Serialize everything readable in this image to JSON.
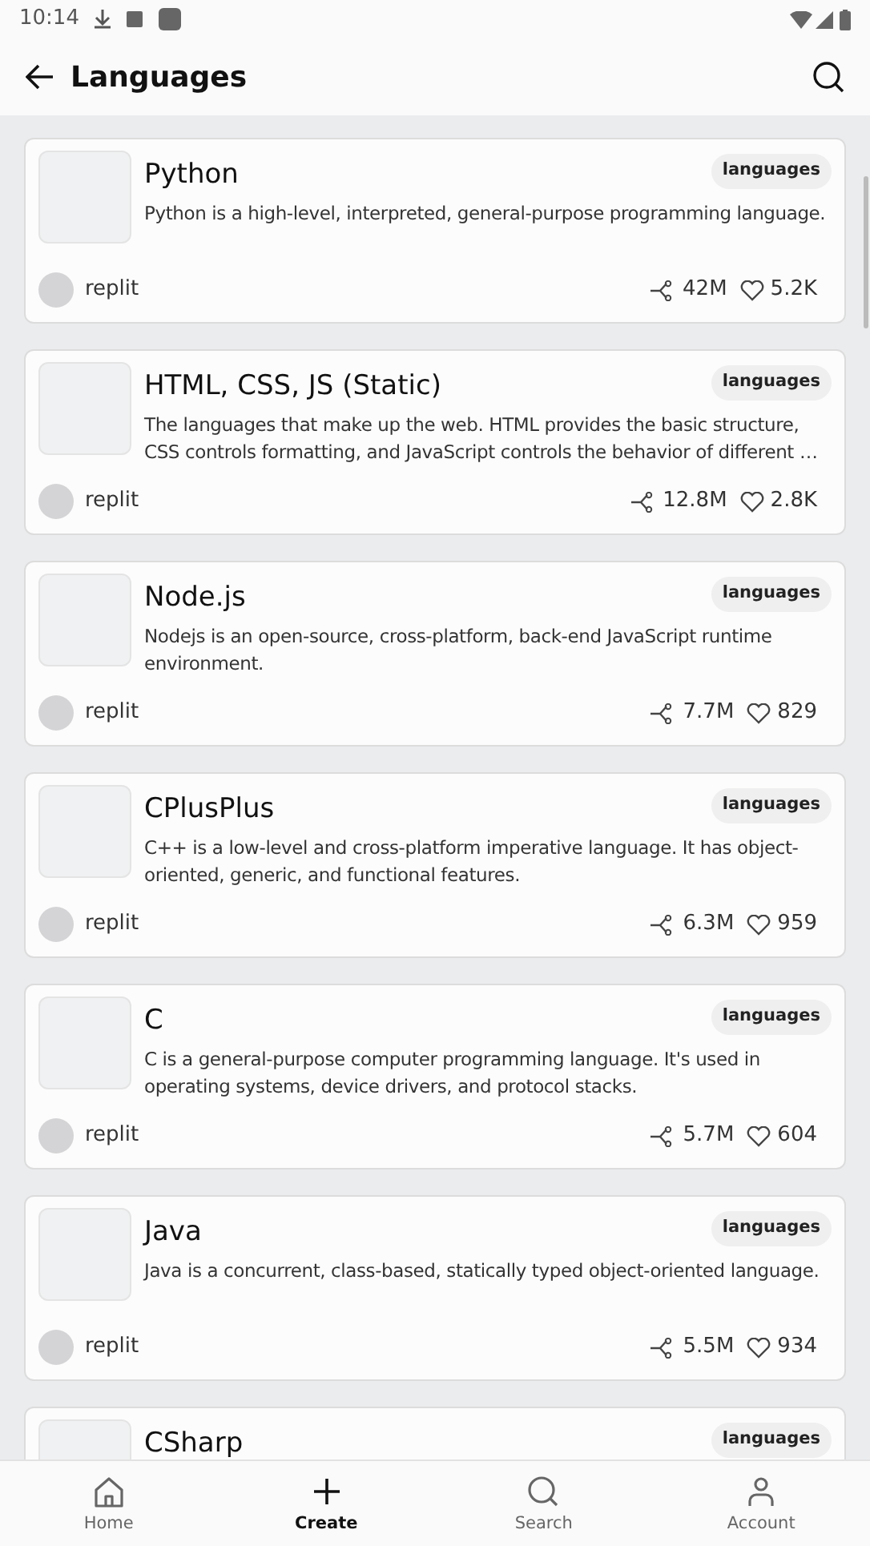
{
  "status_bar": {
    "time": "10:14"
  },
  "header": {
    "title": "Languages"
  },
  "cards": [
    {
      "title": "Python",
      "tag": "languages",
      "description": "Python is a high-level, interpreted, general-purpose programming language.",
      "author": "replit",
      "forks": "42M",
      "likes": "5.2K"
    },
    {
      "title": "HTML, CSS, JS (Static)",
      "tag": "languages",
      "description": "The languages that make up the web. HTML provides the basic structure, CSS controls formatting, and JavaScript controls the behavior of different …",
      "author": "replit",
      "forks": "12.8M",
      "likes": "2.8K"
    },
    {
      "title": "Node.js",
      "tag": "languages",
      "description": "Nodejs is an open-source, cross-platform, back-end JavaScript runtime environment.",
      "author": "replit",
      "forks": "7.7M",
      "likes": "829"
    },
    {
      "title": "CPlusPlus",
      "tag": "languages",
      "description": "C++ is a low-level and cross-platform imperative language. It has object-oriented, generic, and functional features.",
      "author": "replit",
      "forks": "6.3M",
      "likes": "959"
    },
    {
      "title": "C",
      "tag": "languages",
      "description": "C is a general-purpose computer programming language. It's used in operating systems, device drivers, and protocol stacks.",
      "author": "replit",
      "forks": "5.7M",
      "likes": "604"
    },
    {
      "title": "Java",
      "tag": "languages",
      "description": "Java is a concurrent, class-based, statically typed object-oriented language.",
      "author": "replit",
      "forks": "5.5M",
      "likes": "934"
    },
    {
      "title": "CSharp",
      "tag": "languages"
    }
  ],
  "bottom_nav": [
    {
      "label": "Home",
      "kind": "home",
      "selected": false
    },
    {
      "label": "Create",
      "kind": "create",
      "selected": true
    },
    {
      "label": "Search",
      "kind": "search",
      "selected": false
    },
    {
      "label": "Account",
      "kind": "account",
      "selected": false
    }
  ]
}
